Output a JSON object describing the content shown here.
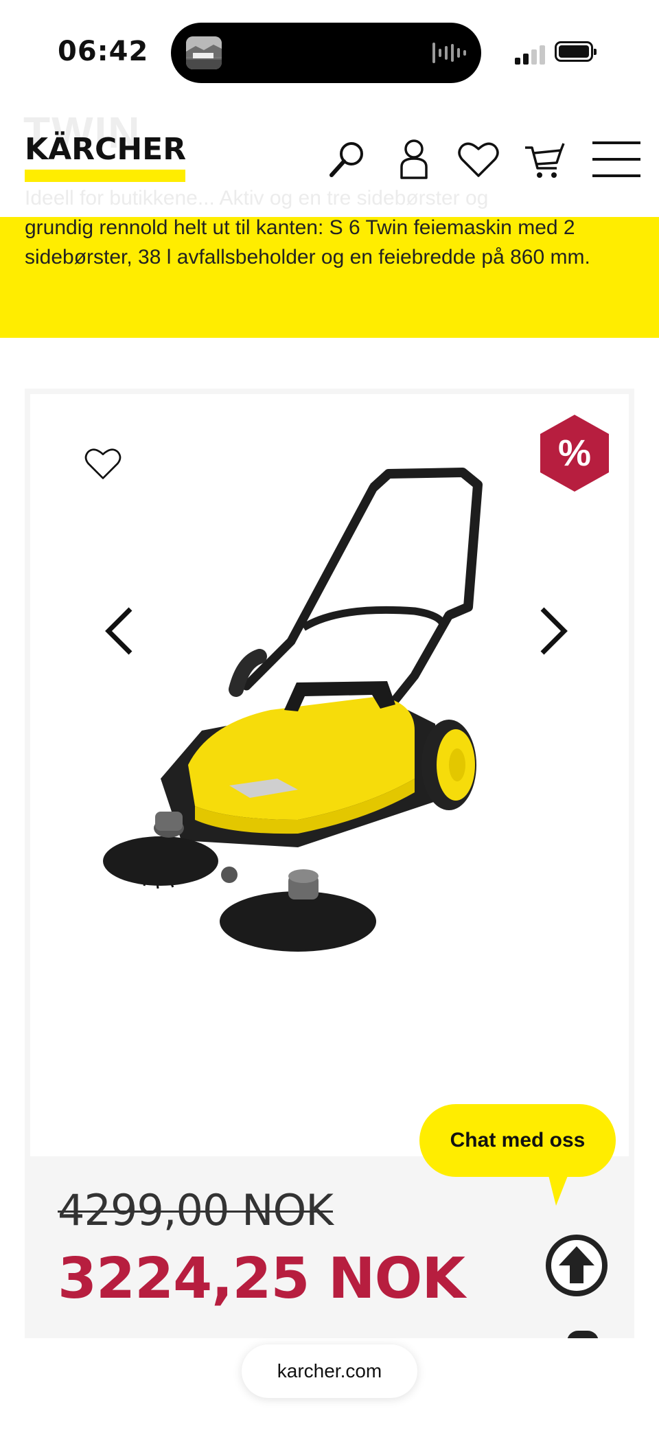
{
  "status_bar": {
    "time": "06:42"
  },
  "header": {
    "logo_text": "KÄRCHER",
    "ghost_title": "TWIN",
    "ghost_text": "Ideell for butikkene... Aktiv og en tre sidebørster og",
    "brand_yellow": "#ffed00",
    "icons": [
      "search-icon",
      "account-icon",
      "heart-icon",
      "cart-icon",
      "menu-icon"
    ]
  },
  "description": {
    "text": "grundig rennold helt ut til kanten: S 6 Twin feiemaskin med 2 sidebørster, 38 l avfallsbeholder og en feiebredde på 860 mm."
  },
  "product": {
    "badge_label": "%",
    "badge_color": "#b71e3f",
    "old_price": "4299,00 NOK",
    "new_price": "3224,25 NOK",
    "price_color": "#b71e3f"
  },
  "chat": {
    "label": "Chat med oss"
  },
  "browser": {
    "url": "karcher.com"
  }
}
